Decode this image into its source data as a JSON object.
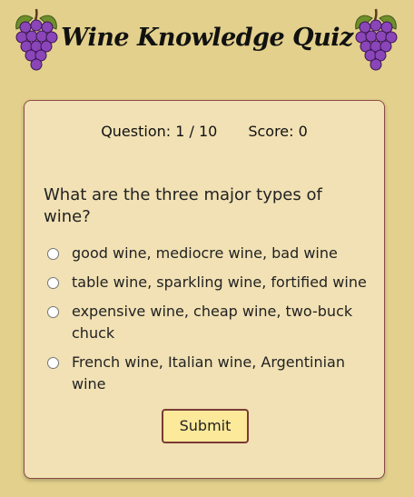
{
  "header": {
    "title": "Wine Knowledge Quiz",
    "left_icon": "grapes-icon",
    "right_icon": "grapes-icon"
  },
  "status": {
    "question_label": "Question: 1 / 10",
    "score_label": "Score: 0"
  },
  "quiz": {
    "question": "What are the three major types of wine?",
    "options": [
      "good wine, mediocre wine, bad wine",
      "table wine, sparkling wine, fortified wine",
      "expensive wine, cheap wine, two-buck chuck",
      "French wine, Italian wine, Argentinian wine"
    ],
    "submit_label": "Submit"
  },
  "colors": {
    "page_background": "#e2d08c",
    "card_background": "#f1e1b4",
    "card_border": "#8a4a46",
    "button_background": "#fde99a",
    "grape": "#7b3fa6",
    "leaf": "#5f7f2a"
  }
}
